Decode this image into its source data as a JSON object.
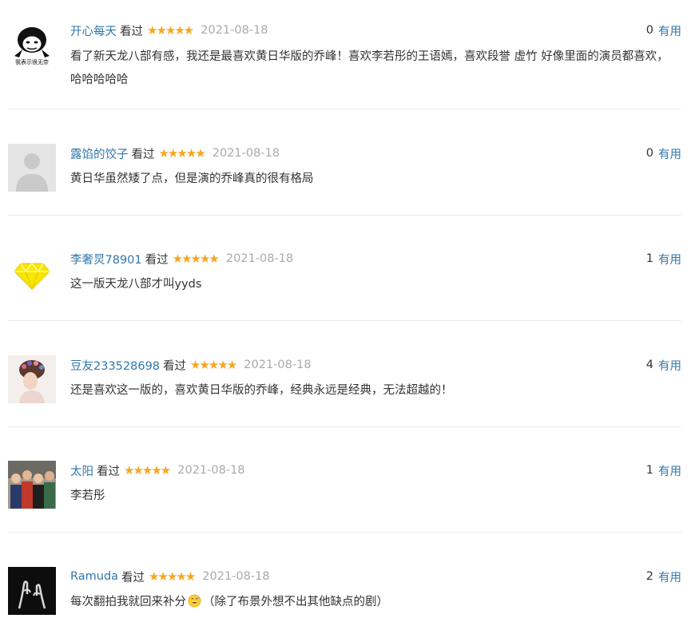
{
  "watched_label": "看过",
  "useful_label": "有用",
  "stars_glyph": "★★★★★",
  "colors": {
    "link": "#3377aa",
    "star": "#f5a623",
    "date": "#aaaaaa",
    "divider": "#ececec"
  },
  "reviews": [
    {
      "user": "开心每天",
      "avatar_icon": "meme-avatar-icon",
      "avatar_caption": "我表示很无奈",
      "rating": 5,
      "date": "2021-08-18",
      "votes": "0",
      "content": "看了新天龙八部有感，我还是最喜欢黄日华版的乔峰！喜欢李若彤的王语嫣，喜欢段誉 虚竹 好像里面的演员都喜欢，哈哈哈哈哈"
    },
    {
      "user": "露馅的饺子",
      "avatar_icon": "default-user-avatar-icon",
      "rating": 5,
      "date": "2021-08-18",
      "votes": "0",
      "content": "黄日华虽然矮了点，但是演的乔峰真的很有格局"
    },
    {
      "user": "李奢炅78901",
      "avatar_icon": "diamond-avatar-icon",
      "rating": 5,
      "date": "2021-08-18",
      "votes": "1",
      "content": "这一版天龙八部才叫yyds"
    },
    {
      "user": "豆友233528698",
      "avatar_icon": "girl-avatar-icon",
      "rating": 5,
      "date": "2021-08-18",
      "votes": "4",
      "content": "还是喜欢这一版的，喜欢黄日华版的乔峰，经典永远是经典，无法超越的！"
    },
    {
      "user": "太阳",
      "avatar_icon": "group-photo-avatar-icon",
      "rating": 5,
      "date": "2021-08-18",
      "votes": "1",
      "content": "李若彤"
    },
    {
      "user": "Ramuda",
      "avatar_icon": "hands-avatar-icon",
      "rating": 5,
      "date": "2021-08-18",
      "votes": "2",
      "content": "每次翻拍我就回来补分",
      "emoji_icon": "grinning-sweat-emoji-icon",
      "content_tail": "（除了布景外想不出其他缺点的剧）"
    }
  ]
}
